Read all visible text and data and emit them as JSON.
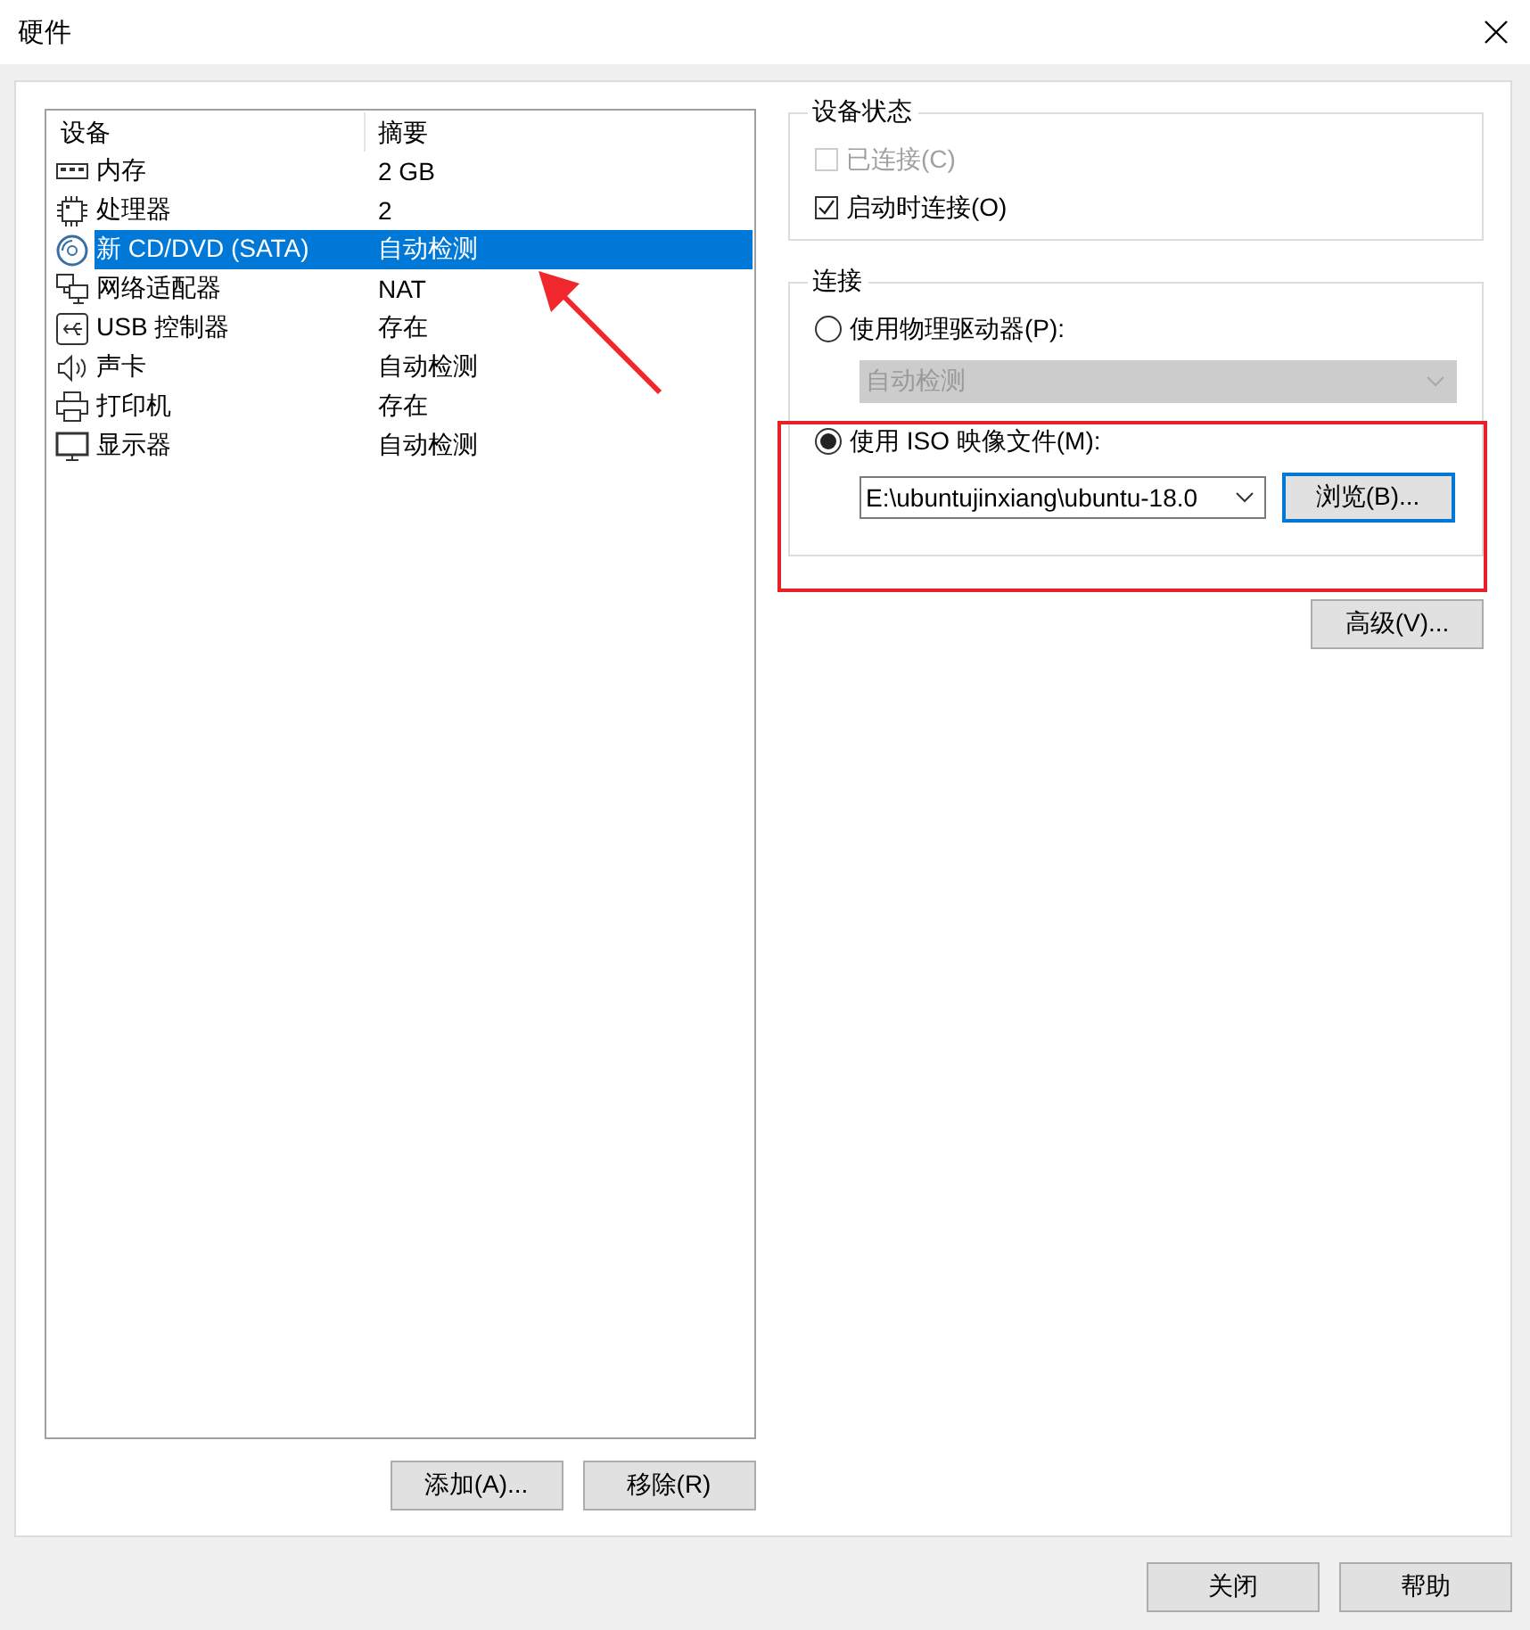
{
  "window": {
    "title": "硬件"
  },
  "devices": {
    "columns": [
      "设备",
      "摘要"
    ],
    "rows": [
      {
        "kind": "memory",
        "name": "内存",
        "summary": "2 GB",
        "selected": false
      },
      {
        "kind": "cpu",
        "name": "处理器",
        "summary": "2",
        "selected": false
      },
      {
        "kind": "disc",
        "name": "新 CD/DVD (SATA)",
        "summary": "自动检测",
        "selected": true
      },
      {
        "kind": "network",
        "name": "网络适配器",
        "summary": "NAT",
        "selected": false
      },
      {
        "kind": "usb",
        "name": "USB 控制器",
        "summary": "存在",
        "selected": false
      },
      {
        "kind": "sound",
        "name": "声卡",
        "summary": "自动检测",
        "selected": false
      },
      {
        "kind": "printer",
        "name": "打印机",
        "summary": "存在",
        "selected": false
      },
      {
        "kind": "monitor",
        "name": "显示器",
        "summary": "自动检测",
        "selected": false
      }
    ]
  },
  "list_buttons": [
    "添加(A)...",
    "移除(R)"
  ],
  "device_status": {
    "title": "设备状态",
    "options": [
      {
        "label": "已连接(C)",
        "checked": false,
        "disabled": true
      },
      {
        "label": "启动时连接(O)",
        "checked": true,
        "disabled": false
      }
    ]
  },
  "connection": {
    "title": "连接",
    "options": [
      {
        "kind": "drive",
        "label": "使用物理驱动器(P):",
        "selected": false,
        "field": {
          "value": "自动检测",
          "disabled": true
        }
      },
      {
        "kind": "iso",
        "label": "使用 ISO 映像文件(M):",
        "selected": true,
        "field": {
          "value": "E:\\ubuntujinxiang\\ubuntu-18.0",
          "disabled": false
        },
        "button": "浏览(B)..."
      }
    ]
  },
  "advanced_button": "高级(V)...",
  "footer_buttons": [
    "关闭",
    "帮助"
  ]
}
